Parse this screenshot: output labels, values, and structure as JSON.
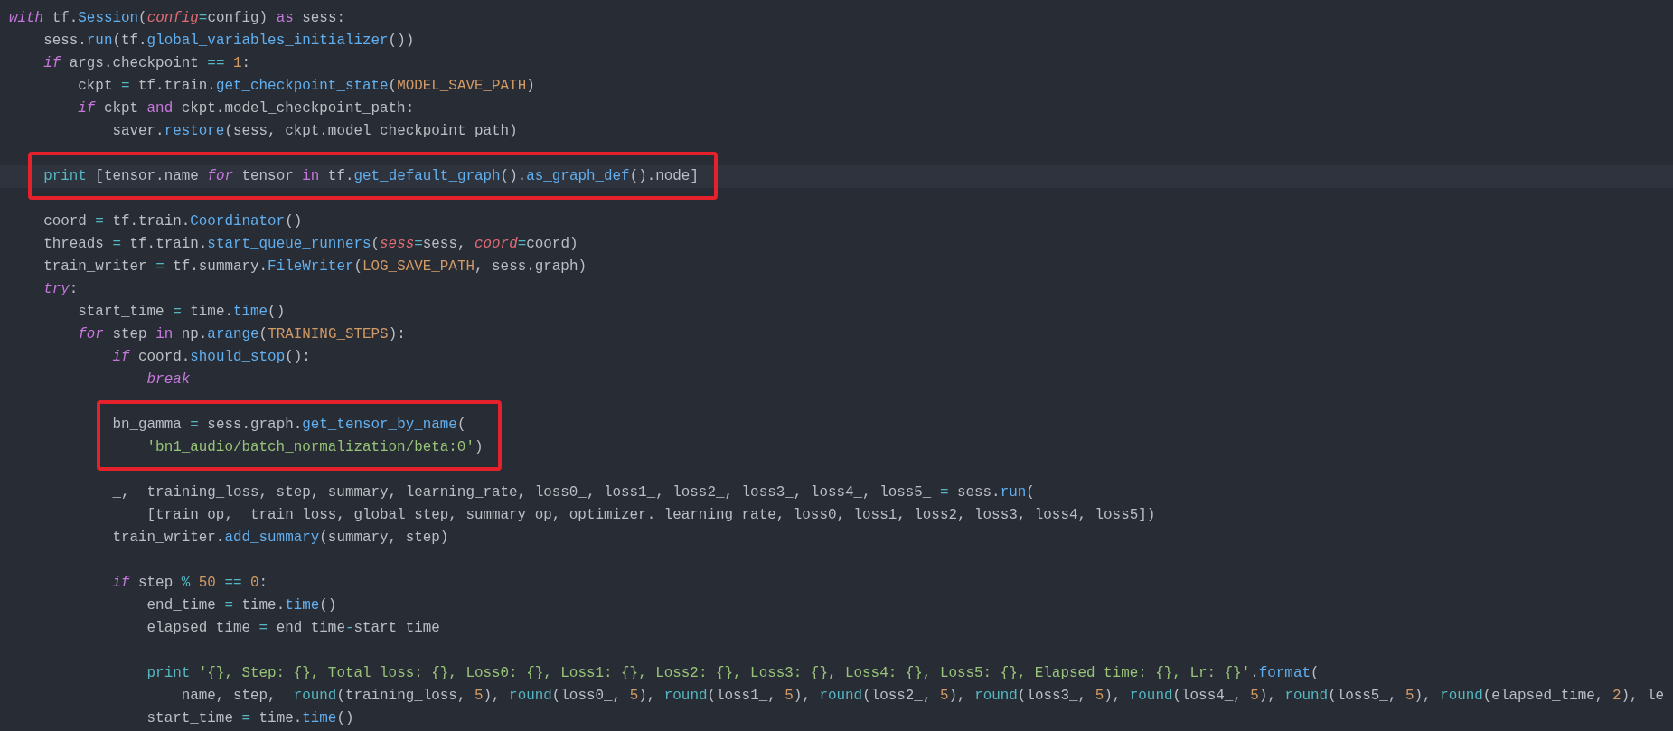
{
  "editor": {
    "blocks": [
      {
        "kind": "plain",
        "lines": [
          {
            "tokens": [
              {
                "text": "with",
                "kind": "keyword"
              },
              {
                "text": " tf.",
                "kind": "plain"
              },
              {
                "text": "Session",
                "kind": "function"
              },
              {
                "text": "(",
                "kind": "plain"
              },
              {
                "text": "config",
                "kind": "param"
              },
              {
                "text": "=",
                "kind": "operator"
              },
              {
                "text": "config) ",
                "kind": "plain"
              },
              {
                "text": "as",
                "kind": "word"
              },
              {
                "text": " sess:",
                "kind": "plain"
              }
            ]
          },
          {
            "tokens": [
              {
                "text": "    sess.",
                "kind": "plain"
              },
              {
                "text": "run",
                "kind": "function"
              },
              {
                "text": "(tf.",
                "kind": "plain"
              },
              {
                "text": "global_variables_initializer",
                "kind": "function"
              },
              {
                "text": "())",
                "kind": "plain"
              }
            ]
          },
          {
            "tokens": [
              {
                "text": "    if",
                "kind": "keyword"
              },
              {
                "text": " args.checkpoint ",
                "kind": "plain"
              },
              {
                "text": "==",
                "kind": "operator"
              },
              {
                "text": " 1",
                "kind": "number"
              },
              {
                "text": ":",
                "kind": "plain"
              }
            ]
          },
          {
            "tokens": [
              {
                "text": "        ckpt ",
                "kind": "plain"
              },
              {
                "text": "=",
                "kind": "operator"
              },
              {
                "text": " tf.train.",
                "kind": "plain"
              },
              {
                "text": "get_checkpoint_state",
                "kind": "function"
              },
              {
                "text": "(",
                "kind": "plain"
              },
              {
                "text": "MODEL_SAVE_PATH",
                "kind": "constant"
              },
              {
                "text": ")",
                "kind": "plain"
              }
            ]
          },
          {
            "tokens": [
              {
                "text": "        if",
                "kind": "keyword"
              },
              {
                "text": " ckpt ",
                "kind": "plain"
              },
              {
                "text": "and",
                "kind": "word"
              },
              {
                "text": " ckpt.model_checkpoint_path:",
                "kind": "plain"
              }
            ]
          },
          {
            "tokens": [
              {
                "text": "            saver.",
                "kind": "plain"
              },
              {
                "text": "restore",
                "kind": "function"
              },
              {
                "text": "(sess, ckpt.model_checkpoint_path)",
                "kind": "plain"
              }
            ]
          },
          {
            "kind": "blank"
          }
        ]
      },
      {
        "kind": "boxed_current",
        "lines": [
          {
            "tokens": [
              {
                "text": "    print",
                "kind": "builtin"
              },
              {
                "text": " [tensor.name ",
                "kind": "plain"
              },
              {
                "text": "for",
                "kind": "keyword"
              },
              {
                "text": " tensor ",
                "kind": "plain"
              },
              {
                "text": "in",
                "kind": "word"
              },
              {
                "text": " tf.",
                "kind": "plain"
              },
              {
                "text": "get_default_graph",
                "kind": "function"
              },
              {
                "text": "().",
                "kind": "plain"
              },
              {
                "text": "as_graph_def",
                "kind": "function"
              },
              {
                "text": "().node]",
                "kind": "plain"
              }
            ]
          }
        ]
      },
      {
        "kind": "plain",
        "lines": [
          {
            "kind": "blank"
          },
          {
            "tokens": [
              {
                "text": "    coord ",
                "kind": "plain"
              },
              {
                "text": "=",
                "kind": "operator"
              },
              {
                "text": " tf.train.",
                "kind": "plain"
              },
              {
                "text": "Coordinator",
                "kind": "function"
              },
              {
                "text": "()",
                "kind": "plain"
              }
            ]
          },
          {
            "tokens": [
              {
                "text": "    threads ",
                "kind": "plain"
              },
              {
                "text": "=",
                "kind": "operator"
              },
              {
                "text": " tf.train.",
                "kind": "plain"
              },
              {
                "text": "start_queue_runners",
                "kind": "function"
              },
              {
                "text": "(",
                "kind": "plain"
              },
              {
                "text": "sess",
                "kind": "param"
              },
              {
                "text": "=",
                "kind": "operator"
              },
              {
                "text": "sess, ",
                "kind": "plain"
              },
              {
                "text": "coord",
                "kind": "param"
              },
              {
                "text": "=",
                "kind": "operator"
              },
              {
                "text": "coord)",
                "kind": "plain"
              }
            ]
          },
          {
            "tokens": [
              {
                "text": "    train_writer ",
                "kind": "plain"
              },
              {
                "text": "=",
                "kind": "operator"
              },
              {
                "text": " tf.summary.",
                "kind": "plain"
              },
              {
                "text": "FileWriter",
                "kind": "function"
              },
              {
                "text": "(",
                "kind": "plain"
              },
              {
                "text": "LOG_SAVE_PATH",
                "kind": "constant"
              },
              {
                "text": ", sess.graph)",
                "kind": "plain"
              }
            ]
          },
          {
            "tokens": [
              {
                "text": "    try",
                "kind": "keyword"
              },
              {
                "text": ":",
                "kind": "plain"
              }
            ]
          },
          {
            "tokens": [
              {
                "text": "        start_time ",
                "kind": "plain"
              },
              {
                "text": "=",
                "kind": "operator"
              },
              {
                "text": " time.",
                "kind": "plain"
              },
              {
                "text": "time",
                "kind": "function"
              },
              {
                "text": "()",
                "kind": "plain"
              }
            ]
          },
          {
            "tokens": [
              {
                "text": "        for",
                "kind": "keyword"
              },
              {
                "text": " step ",
                "kind": "plain"
              },
              {
                "text": "in",
                "kind": "word"
              },
              {
                "text": " np.",
                "kind": "plain"
              },
              {
                "text": "arange",
                "kind": "function"
              },
              {
                "text": "(",
                "kind": "plain"
              },
              {
                "text": "TRAINING_STEPS",
                "kind": "constant"
              },
              {
                "text": "):",
                "kind": "plain"
              }
            ]
          },
          {
            "tokens": [
              {
                "text": "            if",
                "kind": "keyword"
              },
              {
                "text": " coord.",
                "kind": "plain"
              },
              {
                "text": "should_stop",
                "kind": "function"
              },
              {
                "text": "():",
                "kind": "plain"
              }
            ]
          },
          {
            "tokens": [
              {
                "text": "                break",
                "kind": "keyword"
              }
            ]
          },
          {
            "kind": "blank"
          }
        ]
      },
      {
        "kind": "boxed",
        "lines": [
          {
            "tokens": [
              {
                "text": "            bn_gamma ",
                "kind": "plain"
              },
              {
                "text": "=",
                "kind": "operator"
              },
              {
                "text": " sess.graph.",
                "kind": "plain"
              },
              {
                "text": "get_tensor_by_name",
                "kind": "function"
              },
              {
                "text": "(",
                "kind": "plain"
              }
            ]
          },
          {
            "tokens": [
              {
                "text": "                'bn1_audio/batch_normalization/beta:0'",
                "kind": "string"
              },
              {
                "text": ")",
                "kind": "plain"
              }
            ]
          }
        ]
      },
      {
        "kind": "plain",
        "lines": [
          {
            "kind": "blank"
          },
          {
            "tokens": [
              {
                "text": "            _,  training_loss, step, summary, learning_rate, loss0_, loss1_, loss2_, loss3_, loss4_, loss5_ ",
                "kind": "plain"
              },
              {
                "text": "=",
                "kind": "operator"
              },
              {
                "text": " sess.",
                "kind": "plain"
              },
              {
                "text": "run",
                "kind": "function"
              },
              {
                "text": "(",
                "kind": "plain"
              }
            ]
          },
          {
            "tokens": [
              {
                "text": "                [train_op,  train_loss, global_step, summary_op, optimizer._learning_rate, loss0, loss1, loss2, loss3, loss4, loss5])",
                "kind": "plain"
              }
            ]
          },
          {
            "tokens": [
              {
                "text": "            train_writer.",
                "kind": "plain"
              },
              {
                "text": "add_summary",
                "kind": "function"
              },
              {
                "text": "(summary, step)",
                "kind": "plain"
              }
            ]
          },
          {
            "kind": "blank"
          },
          {
            "tokens": [
              {
                "text": "            if",
                "kind": "keyword"
              },
              {
                "text": " step ",
                "kind": "plain"
              },
              {
                "text": "%",
                "kind": "operator"
              },
              {
                "text": " 50",
                "kind": "number"
              },
              {
                "text": " ==",
                "kind": "operator"
              },
              {
                "text": " 0",
                "kind": "number"
              },
              {
                "text": ":",
                "kind": "plain"
              }
            ]
          },
          {
            "tokens": [
              {
                "text": "                end_time ",
                "kind": "plain"
              },
              {
                "text": "=",
                "kind": "operator"
              },
              {
                "text": " time.",
                "kind": "plain"
              },
              {
                "text": "time",
                "kind": "function"
              },
              {
                "text": "()",
                "kind": "plain"
              }
            ]
          },
          {
            "tokens": [
              {
                "text": "                elapsed_time ",
                "kind": "plain"
              },
              {
                "text": "=",
                "kind": "operator"
              },
              {
                "text": " end_time",
                "kind": "plain"
              },
              {
                "text": "-",
                "kind": "operator"
              },
              {
                "text": "start_time",
                "kind": "plain"
              }
            ]
          },
          {
            "kind": "blank"
          },
          {
            "tokens": [
              {
                "text": "                print",
                "kind": "builtin"
              },
              {
                "text": " '{}, Step: {}, Total loss: {}, Loss0: {}, Loss1: {}, Loss2: {}, Loss3: {}, Loss4: {}, Loss5: {}, Elapsed time: {}, Lr: {}'",
                "kind": "string"
              },
              {
                "text": ".",
                "kind": "plain"
              },
              {
                "text": "format",
                "kind": "function"
              },
              {
                "text": "(",
                "kind": "plain"
              }
            ]
          },
          {
            "tokens": [
              {
                "text": "                    name, step,  ",
                "kind": "plain"
              },
              {
                "text": "round",
                "kind": "builtin"
              },
              {
                "text": "(training_loss, ",
                "kind": "plain"
              },
              {
                "text": "5",
                "kind": "number"
              },
              {
                "text": "), ",
                "kind": "plain"
              },
              {
                "text": "round",
                "kind": "builtin"
              },
              {
                "text": "(loss0_, ",
                "kind": "plain"
              },
              {
                "text": "5",
                "kind": "number"
              },
              {
                "text": "), ",
                "kind": "plain"
              },
              {
                "text": "round",
                "kind": "builtin"
              },
              {
                "text": "(loss1_, ",
                "kind": "plain"
              },
              {
                "text": "5",
                "kind": "number"
              },
              {
                "text": "), ",
                "kind": "plain"
              },
              {
                "text": "round",
                "kind": "builtin"
              },
              {
                "text": "(loss2_, ",
                "kind": "plain"
              },
              {
                "text": "5",
                "kind": "number"
              },
              {
                "text": "), ",
                "kind": "plain"
              },
              {
                "text": "round",
                "kind": "builtin"
              },
              {
                "text": "(loss3_, ",
                "kind": "plain"
              },
              {
                "text": "5",
                "kind": "number"
              },
              {
                "text": "), ",
                "kind": "plain"
              },
              {
                "text": "round",
                "kind": "builtin"
              },
              {
                "text": "(loss4_, ",
                "kind": "plain"
              },
              {
                "text": "5",
                "kind": "number"
              },
              {
                "text": "), ",
                "kind": "plain"
              },
              {
                "text": "round",
                "kind": "builtin"
              },
              {
                "text": "(loss5_, ",
                "kind": "plain"
              },
              {
                "text": "5",
                "kind": "number"
              },
              {
                "text": "), ",
                "kind": "plain"
              },
              {
                "text": "round",
                "kind": "builtin"
              },
              {
                "text": "(elapsed_time, ",
                "kind": "plain"
              },
              {
                "text": "2",
                "kind": "number"
              },
              {
                "text": "), le",
                "kind": "plain"
              }
            ]
          },
          {
            "tokens": [
              {
                "text": "                start_time ",
                "kind": "plain"
              },
              {
                "text": "=",
                "kind": "operator"
              },
              {
                "text": " time.",
                "kind": "plain"
              },
              {
                "text": "time",
                "kind": "function"
              },
              {
                "text": "()",
                "kind": "plain"
              }
            ]
          }
        ]
      }
    ]
  }
}
